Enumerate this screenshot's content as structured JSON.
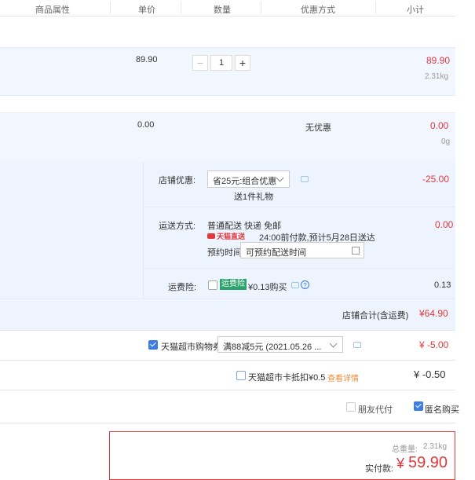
{
  "header": {
    "col_attr": "商品属性",
    "col_price": "单价",
    "col_qty": "数量",
    "col_discount": "优惠方式",
    "col_subtotal": "小计"
  },
  "item1": {
    "price": "89.90",
    "qty": "1",
    "minus": "−",
    "plus": "+",
    "subtotal": "89.90",
    "weight": "2.31kg"
  },
  "item2": {
    "price": "0.00",
    "discount": "无优惠",
    "subtotal": "0.00",
    "weight": "0g"
  },
  "shop": {
    "promo_label": "店铺优惠:",
    "promo_select": "省25元:组合优惠",
    "promo_gift": "送1件礼物",
    "promo_amount": "-25.00",
    "ship_label": "运送方式:",
    "ship_line1": "普通配送 快递 免邮",
    "ship_badge": "天猫直送",
    "ship_line2": "24:00前付款,预计5月28日送达",
    "ship_amount": "0.00",
    "appt_label": "预约时间",
    "appt_placeholder": "可预约配送时间",
    "ins_label": "运费险:",
    "ins_tag": "运费险",
    "ins_price": "¥0.13购买",
    "ins_amount": "0.13",
    "total_label": "店铺合计(含运费)",
    "total_value": "¥64.90"
  },
  "coupon": {
    "label": "天猫超市购物券",
    "select": "满88减5元 (2021.05.26 ...",
    "amount": "¥ -5.00"
  },
  "card": {
    "label": "天猫超市卡抵扣¥0.5",
    "link": "查看详情",
    "amount": "¥ -0.50"
  },
  "options": {
    "friend_pay": "朋友代付",
    "anonymous": "匿名购买"
  },
  "summary": {
    "weight_label": "总重量:",
    "weight_value": "2.31kg",
    "pay_label": "实付款:",
    "pay_currency": "¥",
    "pay_value": "59.90"
  },
  "colors": {
    "accent": "#e4393c",
    "band": "#f2f7ff",
    "checkbox": "#3c7de6"
  }
}
